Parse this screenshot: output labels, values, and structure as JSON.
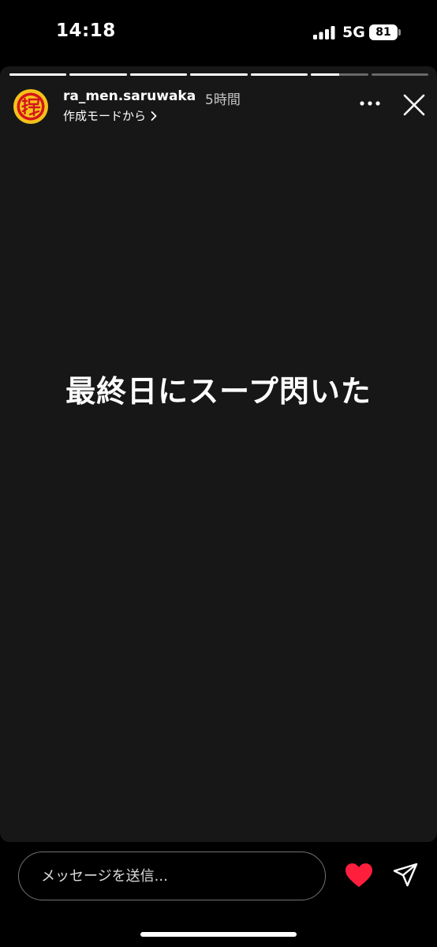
{
  "status_bar": {
    "time": "14:18",
    "network": "5G",
    "battery": "81",
    "icons": [
      "signal-icon",
      "battery-icon"
    ]
  },
  "story": {
    "segments": [
      1,
      1,
      1,
      1,
      1,
      0.5,
      0
    ],
    "username": "ra_men.saruwaka",
    "timestamp": "5時間",
    "subtitle": "作成モードから",
    "text": "最終日にスープ閃いた",
    "icons": [
      "avatar-logo",
      "chevron-right-icon",
      "more-icon",
      "close-icon"
    ]
  },
  "composer": {
    "placeholder": "メッセージを送信...",
    "icons": [
      "heart-icon",
      "send-icon"
    ]
  },
  "colors": {
    "story_background": "#171717",
    "heart": "#ff1f3d",
    "avatar_yellow": "#f4c21a",
    "avatar_red": "#d4151c"
  }
}
